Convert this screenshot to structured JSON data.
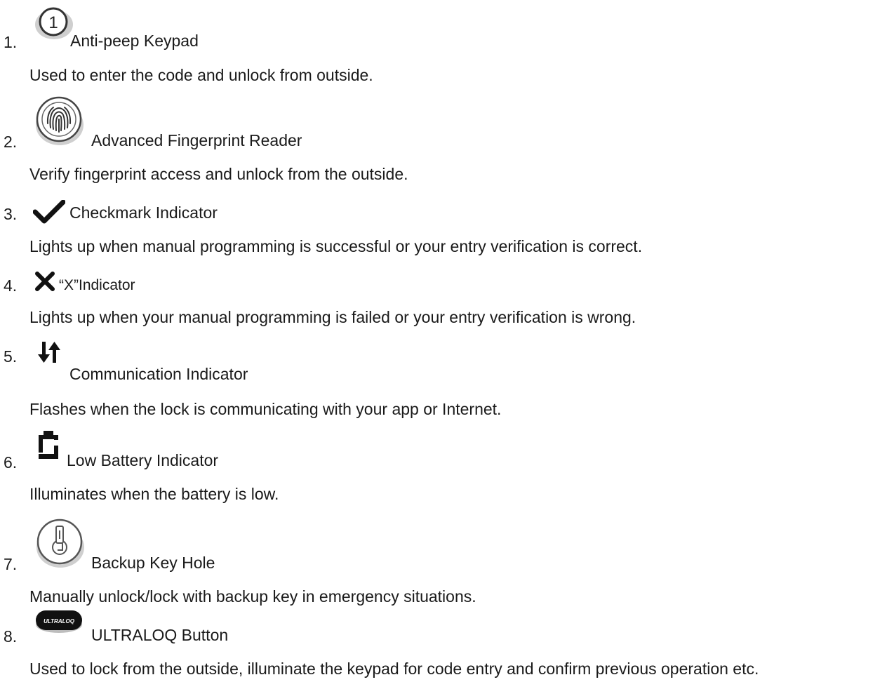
{
  "items": [
    {
      "number": "1.",
      "icon": "numbered-circle-1-icon",
      "icon_glyph": "1",
      "title": "Anti-peep Keypad",
      "description": "Used to enter the code and unlock from outside."
    },
    {
      "number": "2.",
      "icon": "fingerprint-icon",
      "title": "Advanced Fingerprint Reader",
      "description": "Verify fingerprint access and unlock from the outside."
    },
    {
      "number": "3.",
      "icon": "checkmark-icon",
      "title": "Checkmark Indicator",
      "description": "Lights up when manual programming is successful or your entry verification is correct."
    },
    {
      "number": "4.",
      "icon": "x-icon",
      "title": "“X”Indicator",
      "description": "Lights up when your manual programming is failed or your entry verification is wrong."
    },
    {
      "number": "5.",
      "icon": "communication-arrows-icon",
      "title": "Communication Indicator",
      "description": "Flashes when the lock is communicating with your app or Internet."
    },
    {
      "number": "6.",
      "icon": "low-battery-icon",
      "title": "Low Battery Indicator",
      "description": "Illuminates when the battery is low."
    },
    {
      "number": "7.",
      "icon": "key-hole-icon",
      "title": "Backup Key Hole",
      "description": "Manually unlock/lock with backup key in emergency situations."
    },
    {
      "number": "8.",
      "icon": "ultraloq-button-icon",
      "icon_text": "ULTRALOQ",
      "title": "ULTRALOQ Button",
      "description": "Used to lock from the outside, illuminate the keypad for code entry and confirm previous operation etc."
    }
  ]
}
